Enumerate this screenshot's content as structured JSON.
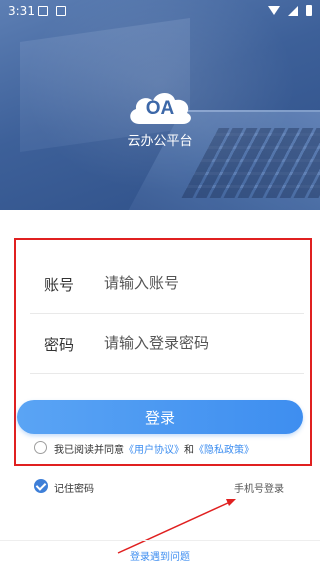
{
  "status_bar": {
    "time": "3:31",
    "left_icons": [
      "image-icon",
      "a-badge-icon"
    ],
    "right_icons": [
      "wifi-icon",
      "cell-signal-icon",
      "battery-icon"
    ]
  },
  "header": {
    "logo_text": "OA",
    "app_name": "云办公平台"
  },
  "form": {
    "account_label": "账号",
    "account_placeholder": "请输入账号",
    "account_value": "",
    "password_label": "密码",
    "password_placeholder": "请输入登录密码",
    "password_value": "",
    "login_button": "登录"
  },
  "agreement": {
    "checked": false,
    "prefix": "我已阅读并同意",
    "user_agreement": "《用户协议》",
    "and": "和",
    "privacy_policy": "《隐私政策》"
  },
  "options": {
    "remember_password": "记住密码",
    "remember_checked": true,
    "phone_login": "手机号登录"
  },
  "footer": {
    "help": "登录遇到问题"
  },
  "colors": {
    "accent": "#3e8ef0",
    "annotation": "#e02020",
    "hero": "#3d6099"
  }
}
